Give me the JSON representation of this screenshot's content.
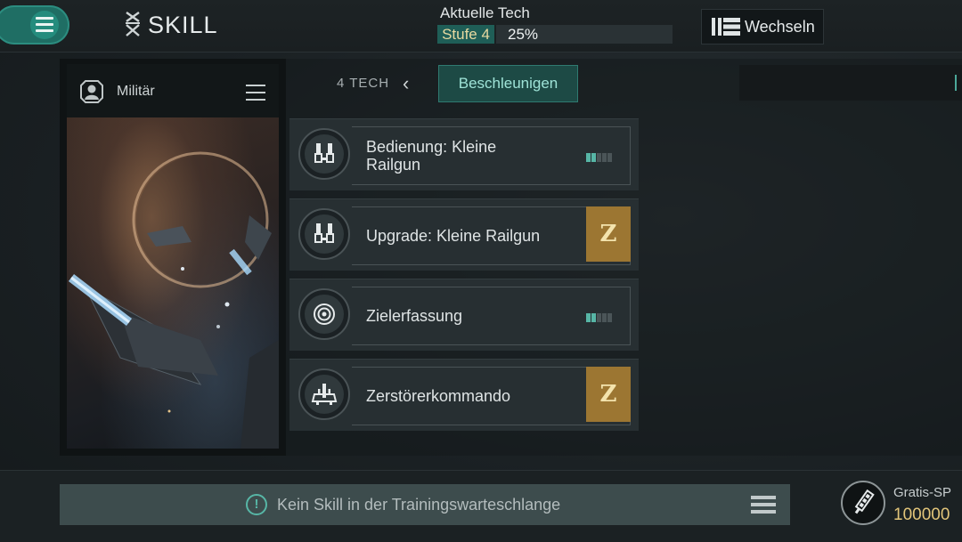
{
  "header": {
    "title": "SKILL",
    "tech_label": "Aktuelle Tech",
    "tech_level": "Stufe 4",
    "tech_percent": "25%",
    "tech_progress": 0.25,
    "switch_label": "Wechseln"
  },
  "sidebar": {
    "category_label": "Militär"
  },
  "tabs": {
    "count_label": "4 TECH",
    "active_label": "Beschleunigen"
  },
  "skills": [
    {
      "name_line1": "Bedienung: Kleine",
      "name_line2": "Railgun",
      "icon": "railgun-icon",
      "status": "pips",
      "level": 2,
      "max_level": 5
    },
    {
      "name": "Upgrade: Kleine Railgun",
      "icon": "railgun-icon",
      "status": "badge",
      "badge": "Z"
    },
    {
      "name": "Zielerfassung",
      "icon": "target-icon",
      "status": "pips",
      "level": 2,
      "max_level": 5
    },
    {
      "name": "Zerstörerkommando",
      "icon": "destroyer-icon",
      "status": "badge",
      "badge": "Z"
    }
  ],
  "queue": {
    "message": "Kein Skill in der Trainingswarteschlange",
    "icon": "exclamation-icon"
  },
  "sp": {
    "label": "Gratis-SP",
    "value": "100000"
  },
  "colors": {
    "accent": "#1f6e64",
    "pip_on": "#57b6a6",
    "pip_off": "#4b5558",
    "badge": "#9c7632",
    "sp_value": "#e2c57a"
  }
}
